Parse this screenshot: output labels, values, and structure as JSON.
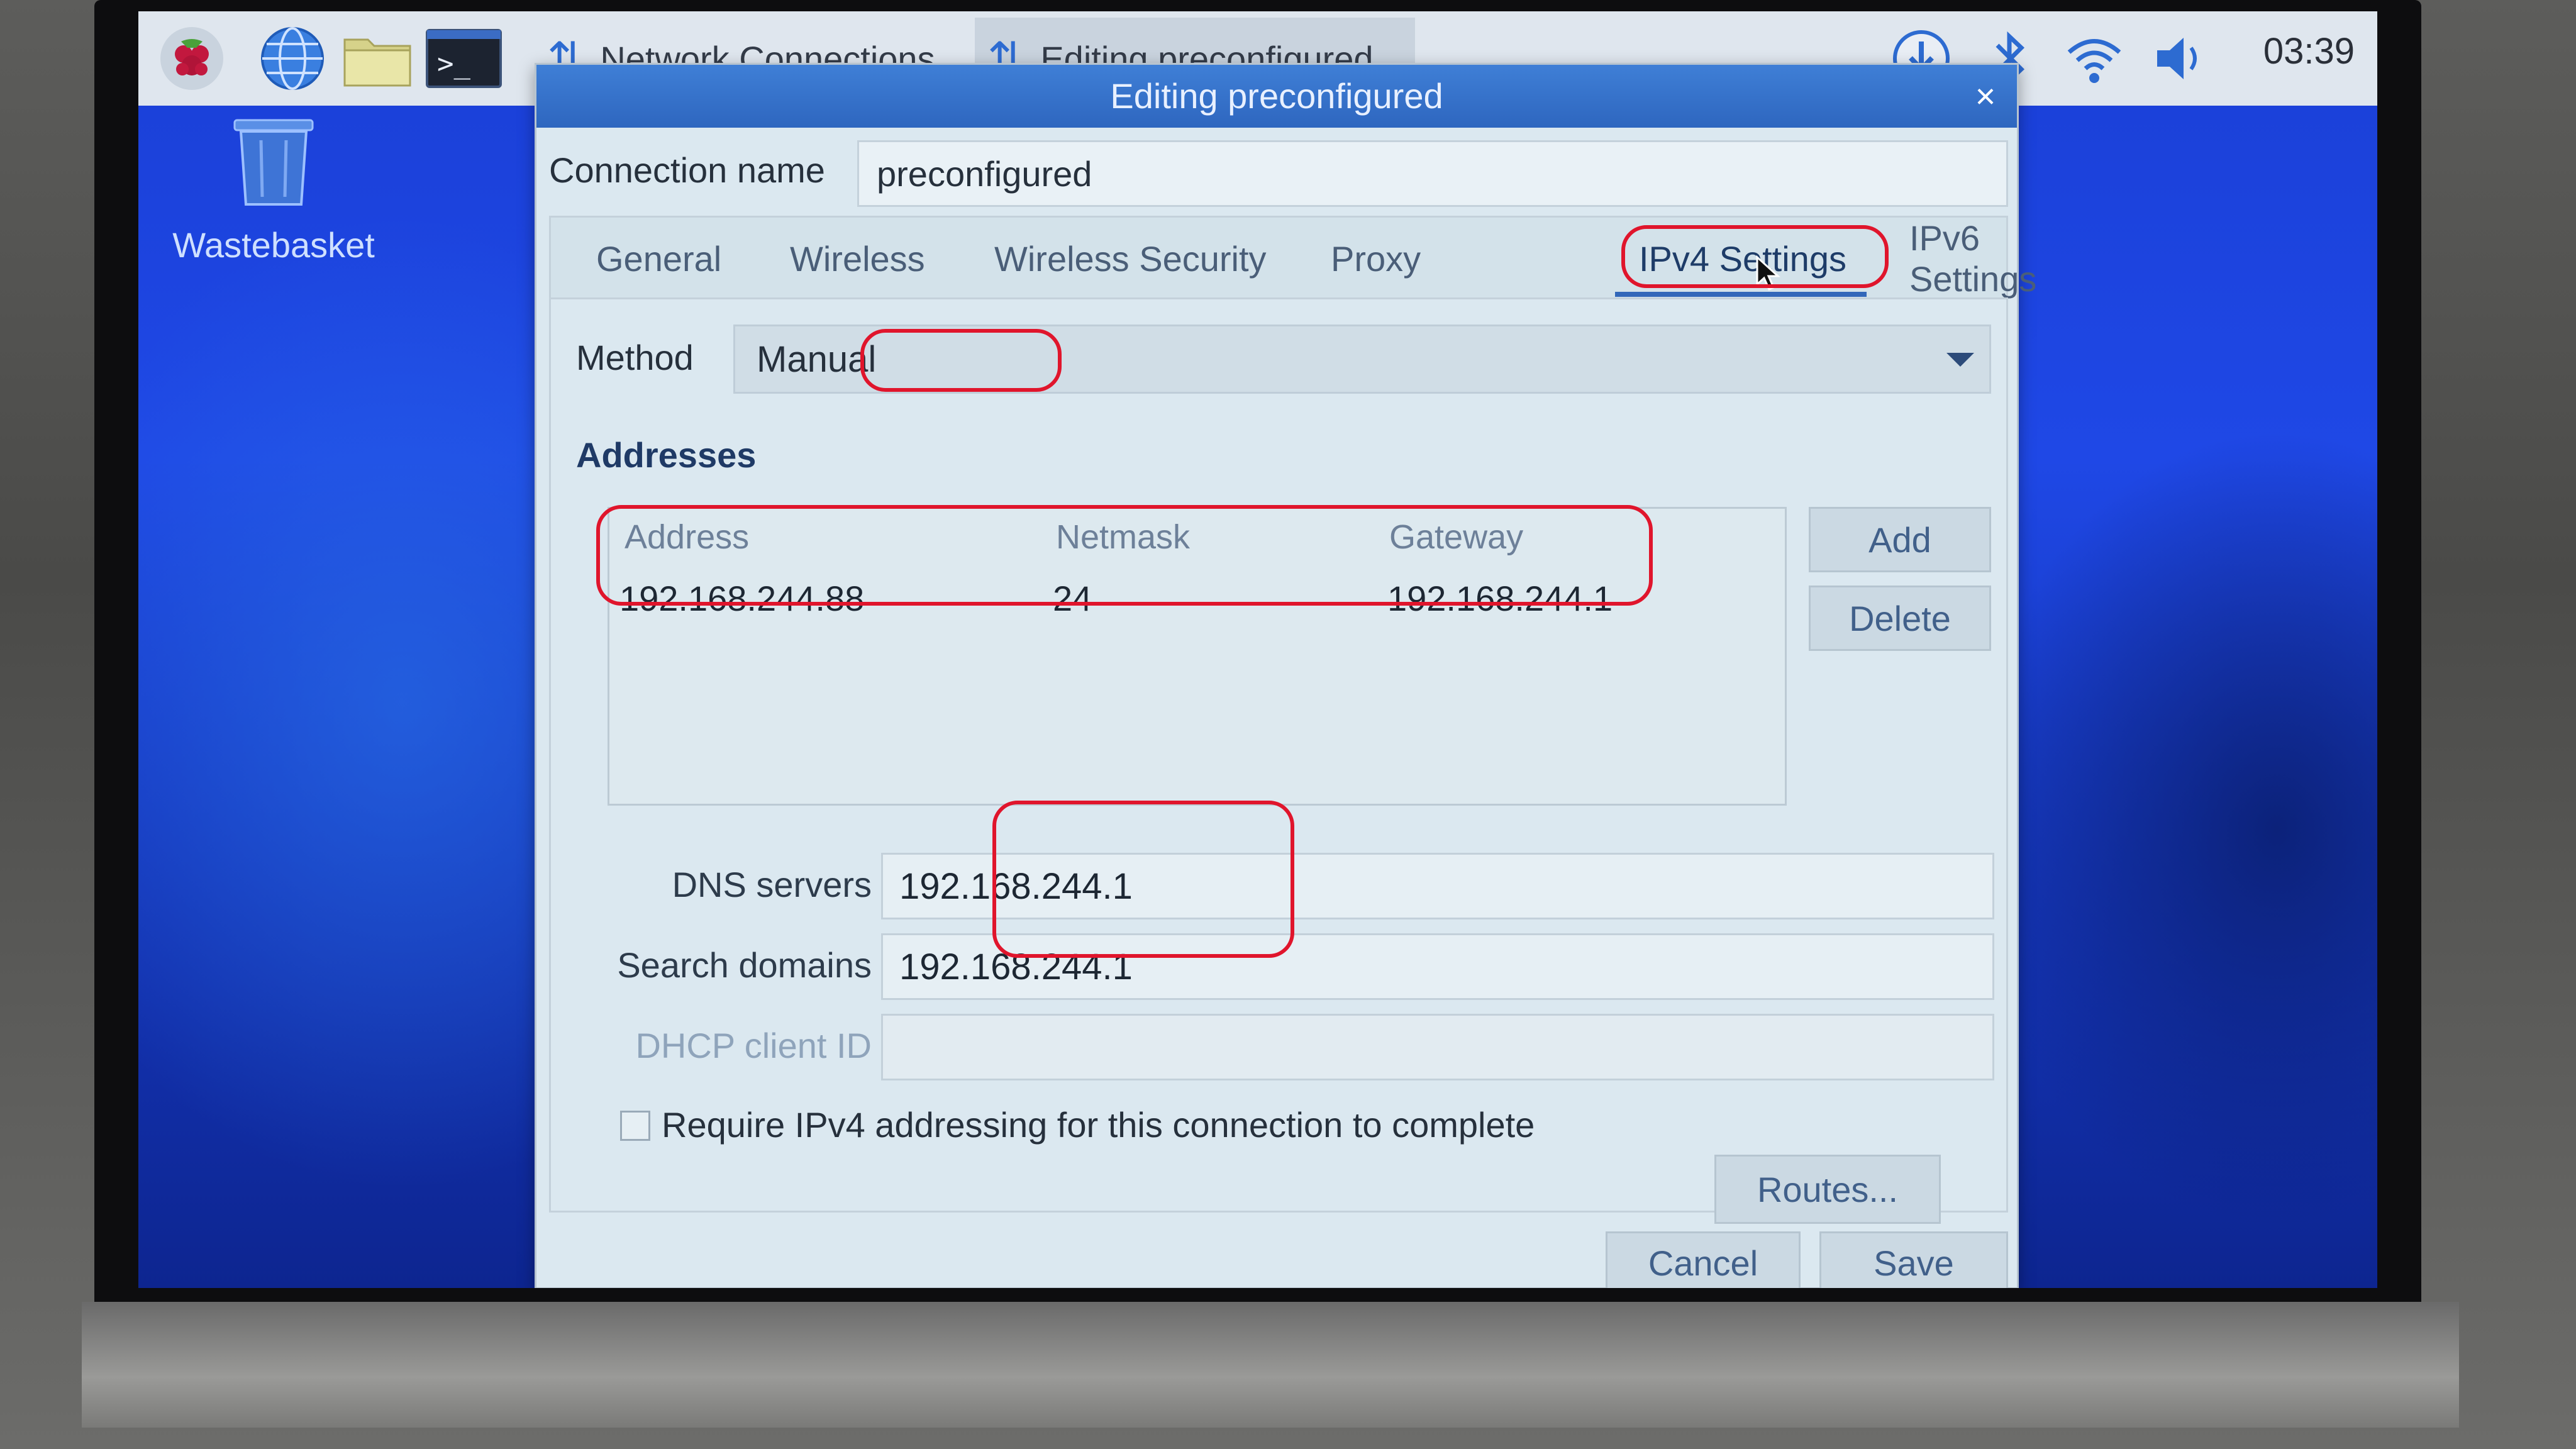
{
  "taskbar": {
    "tasks": [
      {
        "label": "Network Connections"
      },
      {
        "label": "Editing preconfigured"
      }
    ],
    "clock": "03:39"
  },
  "desktop": {
    "wastebasket_label": "Wastebasket"
  },
  "dialog": {
    "title": "Editing preconfigured",
    "connection_name_label": "Connection name",
    "connection_name_value": "preconfigured",
    "tabs": [
      {
        "label": "General"
      },
      {
        "label": "Wireless"
      },
      {
        "label": "Wireless Security"
      },
      {
        "label": "Proxy"
      },
      {
        "label": "IPv4 Settings",
        "active": true
      },
      {
        "label": "IPv6 Settings"
      }
    ],
    "ipv4": {
      "method_label": "Method",
      "method_value": "Manual",
      "addresses_heading": "Addresses",
      "table": {
        "columns": [
          "Address",
          "Netmask",
          "Gateway"
        ],
        "rows": [
          [
            "192.168.244.88",
            "24",
            "192.168.244.1"
          ]
        ]
      },
      "add_button": "Add",
      "delete_button": "Delete",
      "dns_label": "DNS servers",
      "dns_value": "192.168.244.1",
      "search_domains_label": "Search domains",
      "search_domains_value": "192.168.244.1",
      "dhcp_client_id_label": "DHCP client ID",
      "dhcp_client_id_value": "",
      "require_label": "Require IPv4 addressing for this connection to complete",
      "require_checked": false,
      "routes_button": "Routes..."
    },
    "cancel_button": "Cancel",
    "save_button": "Save"
  },
  "colors": {
    "annotation": "#e0152c",
    "titlebar": "#3f7fd6",
    "desktop": "#1f48e6"
  }
}
